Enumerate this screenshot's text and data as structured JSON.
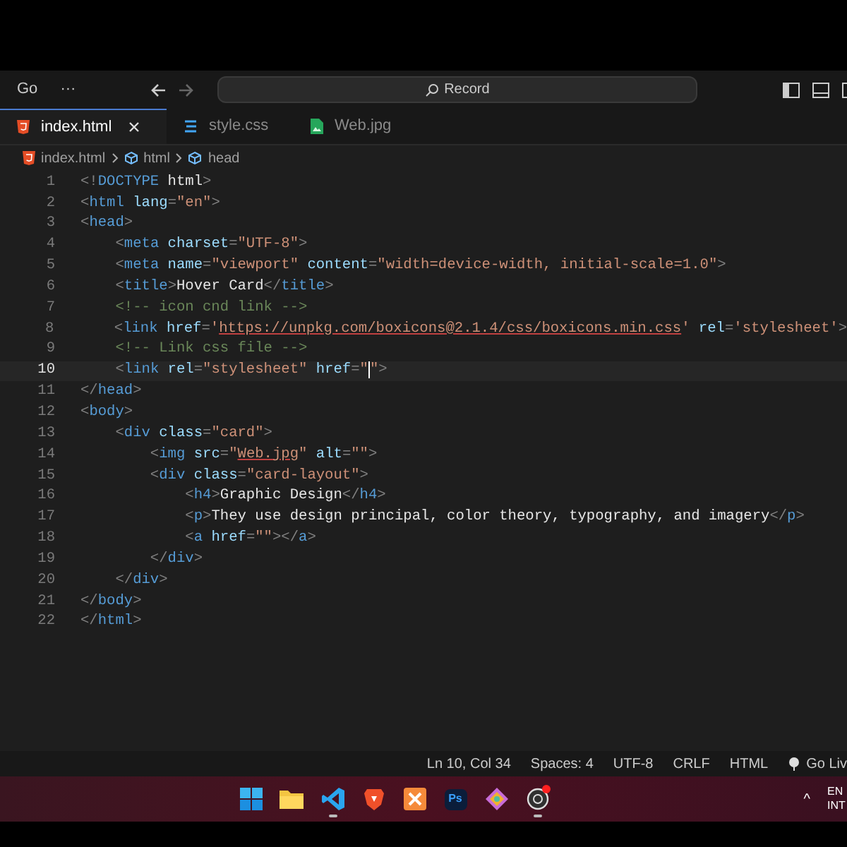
{
  "title_bar": {
    "menu": "Go",
    "more": "···",
    "search": "Record",
    "forward_disabled": true
  },
  "tabs": [
    {
      "label": "index.html",
      "kind": "html",
      "selected": true
    },
    {
      "label": "style.css",
      "kind": "css",
      "selected": false
    },
    {
      "label": "Web.jpg",
      "kind": "image",
      "selected": false
    }
  ],
  "breadcrumb": [
    {
      "label": "index.html",
      "kind": "html"
    },
    {
      "label": "html",
      "kind": "element"
    },
    {
      "label": "head",
      "kind": "element"
    }
  ],
  "code_lines": [
    {
      "number": "1",
      "active": false,
      "tokens": [
        {
          "kind": "p",
          "text": "<!"
        },
        {
          "kind": "t",
          "text": "DOCTYPE"
        },
        {
          "kind": "x",
          "text": " html"
        },
        {
          "kind": "p",
          "text": ">"
        }
      ]
    },
    {
      "number": "2",
      "active": false,
      "tokens": [
        {
          "kind": "p",
          "text": "<"
        },
        {
          "kind": "t",
          "text": "html"
        },
        {
          "kind": "a",
          "text": " lang"
        },
        {
          "kind": "p",
          "text": "="
        },
        {
          "kind": "s",
          "text": "\"en\""
        },
        {
          "kind": "p",
          "text": ">"
        }
      ]
    },
    {
      "number": "3",
      "active": false,
      "tokens": [
        {
          "kind": "p",
          "text": "<"
        },
        {
          "kind": "t",
          "text": "head"
        },
        {
          "kind": "p",
          "text": ">"
        }
      ]
    },
    {
      "number": "4",
      "active": false,
      "tokens": [
        {
          "kind": "p",
          "text": "    <"
        },
        {
          "kind": "t",
          "text": "meta"
        },
        {
          "kind": "a",
          "text": " charset"
        },
        {
          "kind": "p",
          "text": "="
        },
        {
          "kind": "s",
          "text": "\"UTF-8\""
        },
        {
          "kind": "p",
          "text": ">"
        }
      ]
    },
    {
      "number": "5",
      "active": false,
      "tokens": [
        {
          "kind": "p",
          "text": "    <"
        },
        {
          "kind": "t",
          "text": "meta"
        },
        {
          "kind": "a",
          "text": " name"
        },
        {
          "kind": "p",
          "text": "="
        },
        {
          "kind": "s",
          "text": "\"viewport\""
        },
        {
          "kind": "a",
          "text": " content"
        },
        {
          "kind": "p",
          "text": "="
        },
        {
          "kind": "s",
          "text": "\"width=device-width, initial-scale=1.0\""
        },
        {
          "kind": "p",
          "text": ">"
        }
      ]
    },
    {
      "number": "6",
      "active": false,
      "tokens": [
        {
          "kind": "p",
          "text": "    <"
        },
        {
          "kind": "t",
          "text": "title"
        },
        {
          "kind": "p",
          "text": ">"
        },
        {
          "kind": "x",
          "text": "Hover Card"
        },
        {
          "kind": "p",
          "text": "</"
        },
        {
          "kind": "t",
          "text": "title"
        },
        {
          "kind": "p",
          "text": ">"
        }
      ]
    },
    {
      "number": "7",
      "active": false,
      "tokens": [
        {
          "kind": "c",
          "text": "    <!-- icon cnd link -->"
        }
      ]
    },
    {
      "number": "8",
      "active": false,
      "tokens": [
        {
          "kind": "p",
          "text": "    <"
        },
        {
          "kind": "t",
          "text": "link"
        },
        {
          "kind": "a",
          "text": " href"
        },
        {
          "kind": "p",
          "text": "="
        },
        {
          "kind": "s",
          "text": "'"
        },
        {
          "kind": "u",
          "text": "https://unpkg.com/boxicons@2.1.4/css/boxicons.min.css"
        },
        {
          "kind": "s",
          "text": "'"
        },
        {
          "kind": "a",
          "text": " rel"
        },
        {
          "kind": "p",
          "text": "="
        },
        {
          "kind": "s",
          "text": "'stylesheet'"
        },
        {
          "kind": "p",
          "text": ">"
        }
      ]
    },
    {
      "number": "9",
      "active": false,
      "tokens": [
        {
          "kind": "c",
          "text": "    <!-- Link css file -->"
        }
      ]
    },
    {
      "number": "10",
      "active": true,
      "tokens": [
        {
          "kind": "p",
          "text": "    <"
        },
        {
          "kind": "t",
          "text": "link"
        },
        {
          "kind": "a",
          "text": " rel"
        },
        {
          "kind": "p",
          "text": "="
        },
        {
          "kind": "s",
          "text": "\"stylesheet\""
        },
        {
          "kind": "a",
          "text": " href"
        },
        {
          "kind": "p",
          "text": "="
        },
        {
          "kind": "s",
          "text": "\"",
          "caret": true
        },
        {
          "kind": "s",
          "text": "\""
        },
        {
          "kind": "p",
          "text": ">"
        }
      ]
    },
    {
      "number": "11",
      "active": false,
      "tokens": [
        {
          "kind": "p",
          "text": "</"
        },
        {
          "kind": "t",
          "text": "head"
        },
        {
          "kind": "p",
          "text": ">"
        }
      ]
    },
    {
      "number": "12",
      "active": false,
      "tokens": [
        {
          "kind": "p",
          "text": "<"
        },
        {
          "kind": "t",
          "text": "body"
        },
        {
          "kind": "p",
          "text": ">"
        }
      ]
    },
    {
      "number": "13",
      "active": false,
      "tokens": [
        {
          "kind": "p",
          "text": "    <"
        },
        {
          "kind": "t",
          "text": "div"
        },
        {
          "kind": "a",
          "text": " class"
        },
        {
          "kind": "p",
          "text": "="
        },
        {
          "kind": "s",
          "text": "\"card\""
        },
        {
          "kind": "p",
          "text": ">"
        }
      ]
    },
    {
      "number": "14",
      "active": false,
      "tokens": [
        {
          "kind": "p",
          "text": "        <"
        },
        {
          "kind": "t",
          "text": "img"
        },
        {
          "kind": "a",
          "text": " src"
        },
        {
          "kind": "p",
          "text": "="
        },
        {
          "kind": "s",
          "text": "\""
        },
        {
          "kind": "u",
          "text": "Web.jpg"
        },
        {
          "kind": "s",
          "text": "\""
        },
        {
          "kind": "a",
          "text": " alt"
        },
        {
          "kind": "p",
          "text": "="
        },
        {
          "kind": "s",
          "text": "\"\""
        },
        {
          "kind": "p",
          "text": ">"
        }
      ]
    },
    {
      "number": "15",
      "active": false,
      "tokens": [
        {
          "kind": "p",
          "text": "        <"
        },
        {
          "kind": "t",
          "text": "div"
        },
        {
          "kind": "a",
          "text": " class"
        },
        {
          "kind": "p",
          "text": "="
        },
        {
          "kind": "s",
          "text": "\"card-layout\""
        },
        {
          "kind": "p",
          "text": ">"
        }
      ]
    },
    {
      "number": "16",
      "active": false,
      "tokens": [
        {
          "kind": "p",
          "text": "            <"
        },
        {
          "kind": "t",
          "text": "h4"
        },
        {
          "kind": "p",
          "text": ">"
        },
        {
          "kind": "x",
          "text": "Graphic Design"
        },
        {
          "kind": "p",
          "text": "</"
        },
        {
          "kind": "t",
          "text": "h4"
        },
        {
          "kind": "p",
          "text": ">"
        }
      ]
    },
    {
      "number": "17",
      "active": false,
      "tokens": [
        {
          "kind": "p",
          "text": "            <"
        },
        {
          "kind": "t",
          "text": "p"
        },
        {
          "kind": "p",
          "text": ">"
        },
        {
          "kind": "x",
          "text": "They use design principal, color theory, typography, and imagery"
        },
        {
          "kind": "p",
          "text": "</"
        },
        {
          "kind": "t",
          "text": "p"
        },
        {
          "kind": "p",
          "text": ">"
        }
      ]
    },
    {
      "number": "18",
      "active": false,
      "tokens": [
        {
          "kind": "p",
          "text": "            <"
        },
        {
          "kind": "t",
          "text": "a"
        },
        {
          "kind": "a",
          "text": " href"
        },
        {
          "kind": "p",
          "text": "="
        },
        {
          "kind": "s",
          "text": "\"\""
        },
        {
          "kind": "p",
          "text": "></"
        },
        {
          "kind": "t",
          "text": "a"
        },
        {
          "kind": "p",
          "text": ">"
        }
      ]
    },
    {
      "number": "19",
      "active": false,
      "tokens": [
        {
          "kind": "p",
          "text": "        </"
        },
        {
          "kind": "t",
          "text": "div"
        },
        {
          "kind": "p",
          "text": ">"
        }
      ]
    },
    {
      "number": "20",
      "active": false,
      "tokens": [
        {
          "kind": "p",
          "text": "    </"
        },
        {
          "kind": "t",
          "text": "div"
        },
        {
          "kind": "p",
          "text": ">"
        }
      ]
    },
    {
      "number": "21",
      "active": false,
      "tokens": [
        {
          "kind": "p",
          "text": "</"
        },
        {
          "kind": "t",
          "text": "body"
        },
        {
          "kind": "p",
          "text": ">"
        }
      ]
    },
    {
      "number": "22",
      "active": false,
      "tokens": [
        {
          "kind": "p",
          "text": "</"
        },
        {
          "kind": "t",
          "text": "html"
        },
        {
          "kind": "p",
          "text": ">"
        }
      ]
    }
  ],
  "status_bar": [
    "Ln 10, Col 34",
    "Spaces: 4",
    "UTF-8",
    "CRLF",
    "HTML",
    "Go Liv"
  ],
  "taskbar": [
    {
      "kind": "windows"
    },
    {
      "kind": "folder"
    },
    {
      "kind": "editor",
      "selected": true
    },
    {
      "kind": "shield",
      "selected": false
    },
    {
      "kind": "grid",
      "selected": false
    },
    {
      "kind": "ps",
      "label": "Ps",
      "selected": false
    },
    {
      "kind": "diamond",
      "selected": false
    },
    {
      "kind": "recorder",
      "selected": true
    }
  ],
  "tray": {
    "chevron": "^",
    "language": "EN",
    "layout": "INT"
  }
}
